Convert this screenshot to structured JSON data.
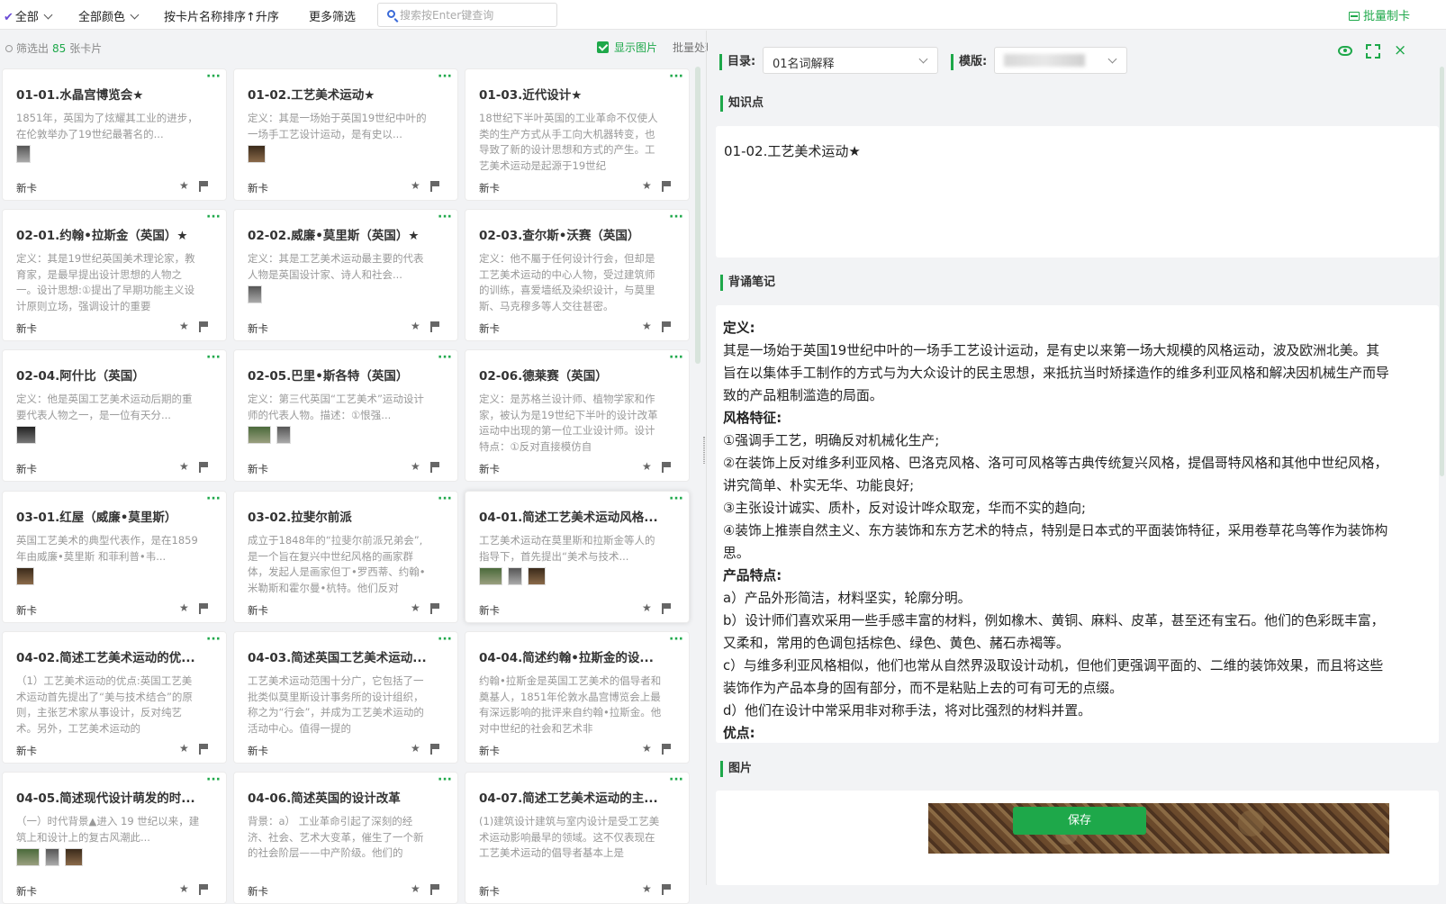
{
  "toolbar": {
    "all": "全部",
    "all_colors": "全部颜色",
    "sort": "按卡片名称排序↑升序",
    "more_filters": "更多筛选",
    "search_placeholder": "搜索按Enter键查询",
    "batch_make": "批量制卡"
  },
  "filter": {
    "prefix": "筛选出",
    "count": "85",
    "suffix": "张卡片",
    "show_images": "显示图片",
    "batch_process": "批量处理"
  },
  "cards": [
    {
      "title": "01-01.水晶宫博览会★",
      "desc": "1851年，英国为了炫耀其工业的进步，在伦敦举办了19世纪最著名的...",
      "thumbs": 1,
      "tag": "新卡"
    },
    {
      "title": "01-02.工艺美术运动★",
      "desc": "定义：其是一场始于英国19世纪中叶的一场手工艺设计运动，是有史以...",
      "thumbs": 1,
      "tag": "新卡"
    },
    {
      "title": "01-03.近代设计★",
      "desc": "18世纪下半叶英国的工业革命不仅使人类的生产方式从手工向大机器转变，也导致了新的设计思想和方式的产生。工艺美术运动是起源于19世纪",
      "thumbs": 0,
      "tag": "新卡"
    },
    {
      "title": "02-01.约翰•拉斯金（英国）★",
      "desc": "定义：其是19世纪英国美术理论家，教育家，是最早提出设计思想的人物之一。设计思想:①提出了早期功能主义设计原则立场，强调设计的重要",
      "thumbs": 0,
      "tag": "新卡"
    },
    {
      "title": "02-02.威廉•莫里斯（英国）★",
      "desc": "定义：其是工艺美术运动最主要的代表人物是英国设计家、诗人和社会...",
      "thumbs": 1,
      "tag": "新卡"
    },
    {
      "title": "02-03.查尔斯•沃赛（英国）",
      "desc": "定义：他不屬于任何设计行会，但却是工艺美术运动的中心人物，受过建筑师的训练，喜爱墙纸及染织设计，与莫里斯、马克穆多等人交往甚密。",
      "thumbs": 0,
      "tag": "新卡"
    },
    {
      "title": "02-04.阿什比（英国）",
      "desc": "定义：他是英国工艺美术运动后期的重要代表人物之一，是一位有天分...",
      "thumbs": 1,
      "tag": "新卡"
    },
    {
      "title": "02-05.巴里•斯各特（英国）",
      "desc": "定义：第三代英国“工艺美术”运动设计师的代表人物。描述：①恨强...",
      "thumbs": 2,
      "tag": "新卡"
    },
    {
      "title": "02-06.德莱赛（英国）",
      "desc": "定义：是苏格兰设计师、植物学家和作家，被认为是19世纪下半叶的设计改革运动中出现的第一位工业设计师。设计特点：①反对直接模仿自",
      "thumbs": 0,
      "tag": "新卡"
    },
    {
      "title": "03-01.红屋（威廉•莫里斯）",
      "desc": "英国工艺美术的典型代表作，是在1859 年由威廉•莫里斯 和菲利普•韦...",
      "thumbs": 1,
      "tag": "新卡"
    },
    {
      "title": "03-02.拉斐尔前派",
      "desc": "成立于1848年的“拉斐尔前派兄弟会”,是一个旨在复兴中世纪风格的画家群体，发起人是画家但丁•罗西蒂、约翰•米勒斯和霍尔曼•杭特。他们反对",
      "thumbs": 0,
      "tag": "新卡"
    },
    {
      "title": "04-01.简述工艺美术运动风格...",
      "desc": "工艺美术运动在莫里斯和拉斯金等人的指导下，首先提出“美术与技术...",
      "thumbs": 3,
      "tag": "新卡"
    },
    {
      "title": "04-02.简述工艺美术运动的优...",
      "desc": "（1）工艺美术运动的优点:英国工艺美术运动首先提出了“美与技术结合”的原则，主张艺术家从事设计，反对纯艺术。另外，工艺美术运动的",
      "thumbs": 0,
      "tag": "新卡"
    },
    {
      "title": "04-03.简述英国工艺美术运动...",
      "desc": "工艺美术运动范围十分广，它包括了一批类似莫里斯设计事务所的设计组织，称之为“行会”，并成为工艺美术运动的活动中心。值得一提的",
      "thumbs": 0,
      "tag": "新卡"
    },
    {
      "title": "04-04.简述约翰•拉斯金的设...",
      "desc": "约翰•拉斯金是英国工艺美术的倡导者和奠基人，1851年伦敦水晶宫博览会上最有深远影响的批评来自约翰•拉斯金。他对中世纪的社会和艺术非",
      "thumbs": 0,
      "tag": "新卡"
    },
    {
      "title": "04-05.简述现代设计萌发的时...",
      "desc": "（一）时代背景▲进入 19 世纪以来，建筑上和设计上的复古风潮此...",
      "thumbs": 3,
      "tag": "新卡"
    },
    {
      "title": "04-06.简述英国的设计改革",
      "desc": "背景：a） 工业革命引起了深刻的经济、社会、艺术大变革，催生了一个新的社会阶层——中产阶级。他们的",
      "thumbs": 0,
      "tag": "新卡"
    },
    {
      "title": "04-07.简述工艺美术运动的主...",
      "desc": "(1)建筑设计建筑与室内设计是受工艺美术运动影响最早的领域。这不仅表现在工艺美术运动的倡导者基本上是",
      "thumbs": 0,
      "tag": "新卡"
    }
  ],
  "editor": {
    "catalog_label": "目录:",
    "catalog_value": "01名词解释",
    "template_label": "模版:",
    "knowledge_title": "知识点",
    "knowledge_text": "01-02.工艺美术运动★",
    "notes_title": "背诵笔记",
    "notes": [
      {
        "bold": true,
        "text": "定义:"
      },
      {
        "bold": false,
        "text": "其是一场始于英国19世纪中叶的一场手工艺设计运动，是有史以来第一场大规模的风格运动，波及欧洲北美。其旨在以集体手工制作的方式与为大众设计的民主思想，来抵抗当时矫揉造作的维多利亚风格和解决因机械生产而导致的产品粗制滥造的局面。"
      },
      {
        "bold": true,
        "text": "风格特征:"
      },
      {
        "bold": false,
        "text": "①强调手工艺，明确反对机械化生产;"
      },
      {
        "bold": false,
        "text": "②在装饰上反对维多利亚风格、巴洛克风格、洛可可风格等古典传统复兴风格，提倡哥特风格和其他中世纪风格，讲究简单、朴实无华、功能良好;"
      },
      {
        "bold": false,
        "text": "③主张设计诚实、质朴，反对设计哗众取宠，华而不实的趋向;"
      },
      {
        "bold": false,
        "text": "④装饰上推崇自然主义、东方装饰和东方艺术的特点，特别是日本式的平面装饰特征，采用卷草花鸟等作为装饰构思。"
      },
      {
        "bold": true,
        "text": "产品特点:"
      },
      {
        "bold": false,
        "text": "a）产品外形简洁，材料坚实，轮廓分明。"
      },
      {
        "bold": false,
        "text": "b）设计师们喜欢采用一些手感丰富的材料，例如橡木、黄铜、麻料、皮革，甚至还有宝石。他们的色彩既丰富，又柔和，常用的色调包括棕色、绿色、黄色、赭石赤褐等。"
      },
      {
        "bold": false,
        "text": "c）与维多利亚风格相似，他们也常从自然界汲取设计动机，但他们更强调平面的、二维的装饰效果，而且将这些装饰作为产品本身的固有部分，而不是粘贴上去的可有可无的点缀。"
      },
      {
        "bold": false,
        "text": "d）他们在设计中常采用非对称手法，将对比强烈的材料并置。"
      },
      {
        "bold": true,
        "text": "优点:"
      }
    ],
    "images_title": "图片",
    "save": "保存"
  },
  "colors": {
    "accent": "#1ea84a",
    "check": "#6a4bd6"
  }
}
